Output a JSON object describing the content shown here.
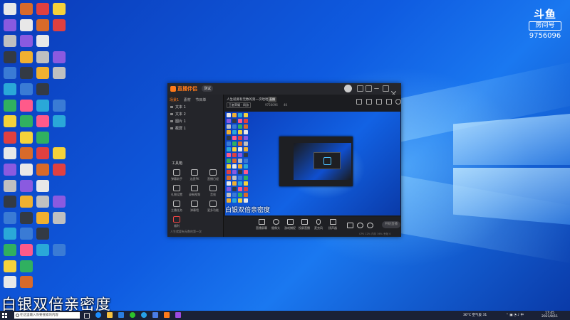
{
  "watermark": {
    "brand": "斗鱼",
    "sub": "房间号",
    "room_number": "9756096"
  },
  "subtitle": "白银双倍亲密度",
  "app": {
    "logo_text": "直播伴侣",
    "badge": "测试",
    "tabs": [
      {
        "label": "场景1",
        "active": true
      },
      {
        "label": "素材"
      },
      {
        "label": "节目单"
      }
    ],
    "scenes": [
      "文本 1",
      "文本 2",
      "图片 1",
      "截屏 1"
    ],
    "tools_header": "工具箱",
    "tools": [
      {
        "label": "弹幕助手"
      },
      {
        "label": "连麦PK"
      },
      {
        "label": "直播日程"
      },
      {
        "label": "礼物设置"
      },
      {
        "label": "录制视频"
      },
      {
        "label": "音效"
      },
      {
        "label": "主播任务"
      },
      {
        "label": "弹幕墙"
      },
      {
        "label": "更多功能"
      },
      {
        "label": "福利"
      }
    ],
    "sidebar_footer": "人生就要有无数的第一次",
    "room_title": "人生就要有无数的第一次哈哈哈",
    "room_tag": "直播",
    "chip_category": "王者荣耀 - 网游",
    "meta_fans": "9756096",
    "meta_count": "4K",
    "preview_caption": "白银双倍亲密度",
    "bottom_tools": [
      {
        "label": "直播屏幕"
      },
      {
        "label": "摄像头"
      },
      {
        "label": "游戏捕捉"
      },
      {
        "label": "投屏直播"
      },
      {
        "label": "麦克风"
      },
      {
        "label": "扬声器"
      }
    ],
    "start_live": "开始直播",
    "status": "CPU 12% 内存 36% 丢帧 0"
  },
  "taskbar": {
    "search_placeholder": "在这里输入你要搜索的内容",
    "weather": "30°C 空气良 31",
    "time": "17:45",
    "date": "2021/8/11"
  },
  "colors": {
    "accent": "#ff7a1a",
    "desktop": "#0f5be0",
    "taskbar": "#1a2136"
  }
}
